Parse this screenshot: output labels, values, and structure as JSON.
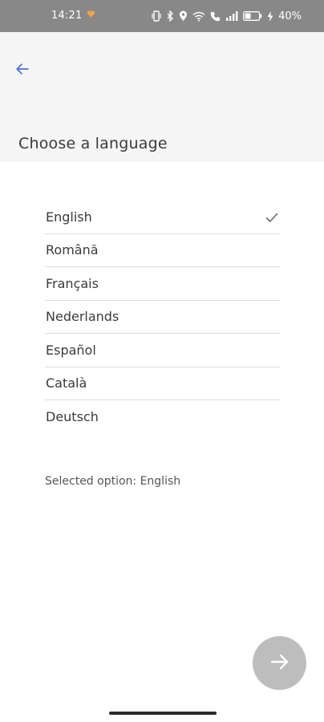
{
  "status_bar": {
    "time": "14:21",
    "battery_percent": "40%",
    "icons": [
      "heart-icon",
      "vibrate-icon",
      "bluetooth-icon",
      "location-icon",
      "wifi-icon",
      "call-icon",
      "signal-icon",
      "battery-icon",
      "charging-icon"
    ]
  },
  "header": {
    "back_icon": "arrow-left-icon",
    "title": "Choose a language"
  },
  "languages": [
    {
      "label": "English",
      "selected": true
    },
    {
      "label": "Română",
      "selected": false
    },
    {
      "label": "Français",
      "selected": false
    },
    {
      "label": "Nederlands",
      "selected": false
    },
    {
      "label": "Español",
      "selected": false
    },
    {
      "label": "Català",
      "selected": false
    },
    {
      "label": "Deutsch",
      "selected": false
    }
  ],
  "selected_text": "Selected option: English",
  "next_button": {
    "icon": "arrow-right-icon"
  },
  "colors": {
    "status_bar": "#888888",
    "header_bg": "#f5f5f5",
    "accent": "#4a6fd6",
    "fab": "#bdbdbd",
    "divider": "#dcdcdc"
  }
}
